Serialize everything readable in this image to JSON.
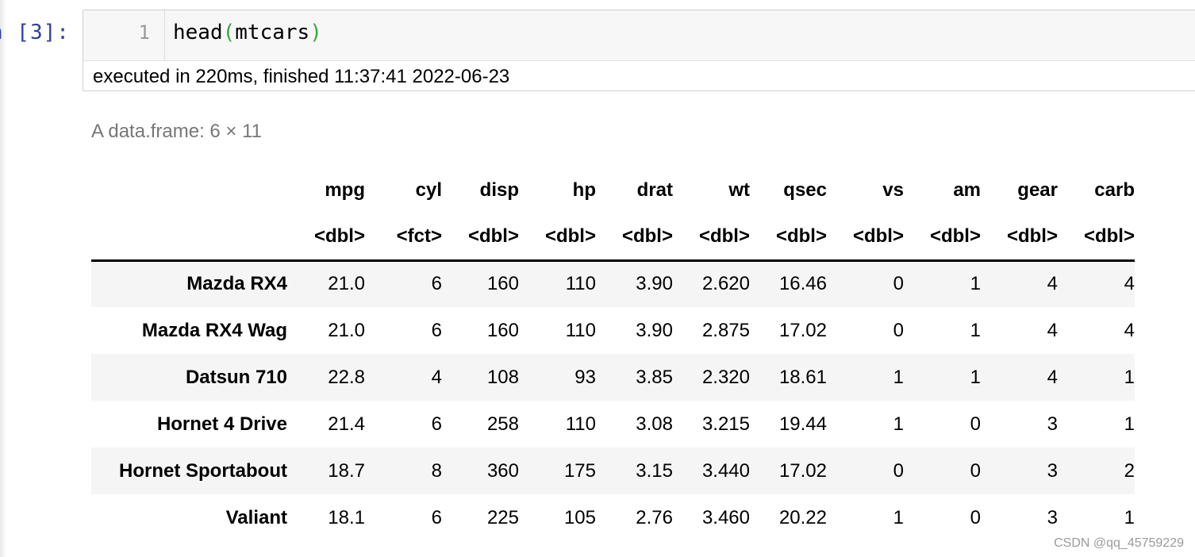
{
  "cell": {
    "prompt": "n [3]:",
    "line_number": "1",
    "code": {
      "func": "head",
      "open_paren": "(",
      "arg": "mtcars",
      "close_paren": ")"
    },
    "exec_info": "executed in 220ms, finished 11:37:41 2022-06-23"
  },
  "output": {
    "caption": "A data.frame: 6 × 11",
    "columns": [
      "mpg",
      "cyl",
      "disp",
      "hp",
      "drat",
      "wt",
      "qsec",
      "vs",
      "am",
      "gear",
      "carb"
    ],
    "types": [
      "<dbl>",
      "<fct>",
      "<dbl>",
      "<dbl>",
      "<dbl>",
      "<dbl>",
      "<dbl>",
      "<dbl>",
      "<dbl>",
      "<dbl>",
      "<dbl>"
    ],
    "rows": [
      {
        "name": "Mazda RX4",
        "values": [
          "21.0",
          "6",
          "160",
          "110",
          "3.90",
          "2.620",
          "16.46",
          "0",
          "1",
          "4",
          "4"
        ]
      },
      {
        "name": "Mazda RX4 Wag",
        "values": [
          "21.0",
          "6",
          "160",
          "110",
          "3.90",
          "2.875",
          "17.02",
          "0",
          "1",
          "4",
          "4"
        ]
      },
      {
        "name": "Datsun 710",
        "values": [
          "22.8",
          "4",
          "108",
          "93",
          "3.85",
          "2.320",
          "18.61",
          "1",
          "1",
          "4",
          "1"
        ]
      },
      {
        "name": "Hornet 4 Drive",
        "values": [
          "21.4",
          "6",
          "258",
          "110",
          "3.08",
          "3.215",
          "19.44",
          "1",
          "0",
          "3",
          "1"
        ]
      },
      {
        "name": "Hornet Sportabout",
        "values": [
          "18.7",
          "8",
          "360",
          "175",
          "3.15",
          "3.440",
          "17.02",
          "0",
          "0",
          "3",
          "2"
        ]
      },
      {
        "name": "Valiant",
        "values": [
          "18.1",
          "6",
          "225",
          "105",
          "2.76",
          "3.460",
          "20.22",
          "1",
          "0",
          "3",
          "1"
        ]
      }
    ]
  },
  "watermark": "CSDN @qq_45759229",
  "colors": {
    "prompt": "#303f9f",
    "paren": "#35a83d",
    "caption": "#777777"
  }
}
